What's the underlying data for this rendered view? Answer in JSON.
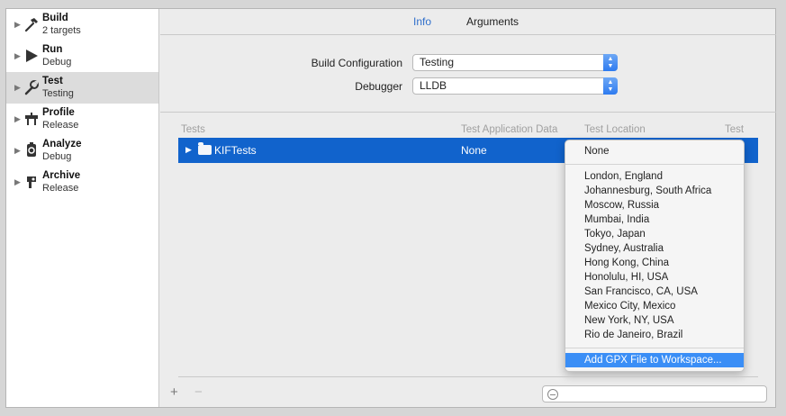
{
  "sidebar": {
    "items": [
      {
        "name": "Build",
        "sub": "2 targets",
        "icon": "hammer-icon"
      },
      {
        "name": "Run",
        "sub": "Debug",
        "icon": "play-icon"
      },
      {
        "name": "Test",
        "sub": "Testing",
        "icon": "wrench-icon"
      },
      {
        "name": "Profile",
        "sub": "Release",
        "icon": "profile-icon"
      },
      {
        "name": "Analyze",
        "sub": "Debug",
        "icon": "analyze-icon"
      },
      {
        "name": "Archive",
        "sub": "Release",
        "icon": "archive-icon"
      }
    ],
    "selected_index": 2
  },
  "tabs": {
    "info": "Info",
    "arguments": "Arguments",
    "active": "Info"
  },
  "config": {
    "build_configuration_label": "Build Configuration",
    "build_configuration_value": "Testing",
    "debugger_label": "Debugger",
    "debugger_value": "LLDB"
  },
  "tests_table": {
    "columns": {
      "tests": "Tests",
      "app_data": "Test Application Data",
      "location": "Test Location",
      "test": "Test"
    },
    "row": {
      "name": "KIFTests",
      "app_data": "None"
    }
  },
  "location_menu": {
    "none": "None",
    "cities": [
      "London, England",
      "Johannesburg, South Africa",
      "Moscow, Russia",
      "Mumbai, India",
      "Tokyo, Japan",
      "Sydney, Australia",
      "Hong Kong, China",
      "Honolulu, HI, USA",
      "San Francisco, CA, USA",
      "Mexico City, Mexico",
      "New York, NY, USA",
      "Rio de Janeiro, Brazil"
    ],
    "add_gpx": "Add GPX File to Workspace..."
  },
  "bottom": {
    "add": "+",
    "remove": "−"
  },
  "colors": {
    "accent": "#1163cc",
    "menu_highlight": "#3a8ef6",
    "tab_active": "#2f6fcb"
  }
}
